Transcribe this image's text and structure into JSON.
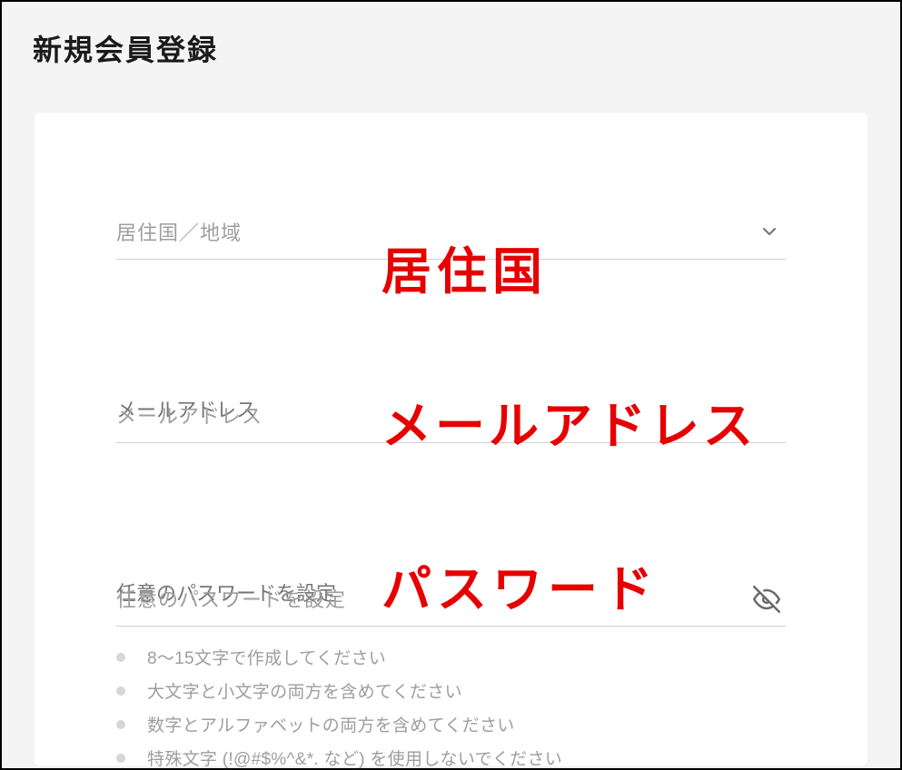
{
  "page": {
    "title": "新規会員登録"
  },
  "form": {
    "country": {
      "placeholder": "居住国／地域",
      "value": ""
    },
    "email": {
      "placeholder": "メールアドレス",
      "value": ""
    },
    "password": {
      "placeholder": "任意のパスワードを設定",
      "value": ""
    },
    "password_rules": [
      "8〜15文字で作成してください",
      "大文字と小文字の両方を含めてください",
      "数字とアルファベットの両方を含めてください",
      "特殊文字 (!@#$%^&*. など) を使用しないでください"
    ]
  },
  "annotations": {
    "country": "居住国",
    "email": "メールアドレス",
    "password": "パスワード"
  }
}
